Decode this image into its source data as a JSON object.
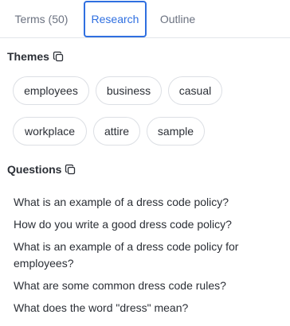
{
  "tabs": [
    {
      "label": "Terms (50)"
    },
    {
      "label": "Research"
    },
    {
      "label": "Outline"
    }
  ],
  "active_tab": "Research",
  "themes": {
    "title": "Themes",
    "chips": [
      "employees",
      "business",
      "casual",
      "workplace",
      "attire",
      "sample"
    ]
  },
  "questions": {
    "title": "Questions",
    "items": [
      "What is an example of a dress code policy?",
      "How do you write a good dress code policy?",
      "What is an example of a dress code policy for employees?",
      "What are some common dress code rules?",
      "What does the word \"dress\" mean?"
    ]
  },
  "colors": {
    "accent": "#2f6fe0",
    "text": "#2b2f36",
    "muted_tab": "#6b7280",
    "chip_border": "#dcdfe4"
  }
}
